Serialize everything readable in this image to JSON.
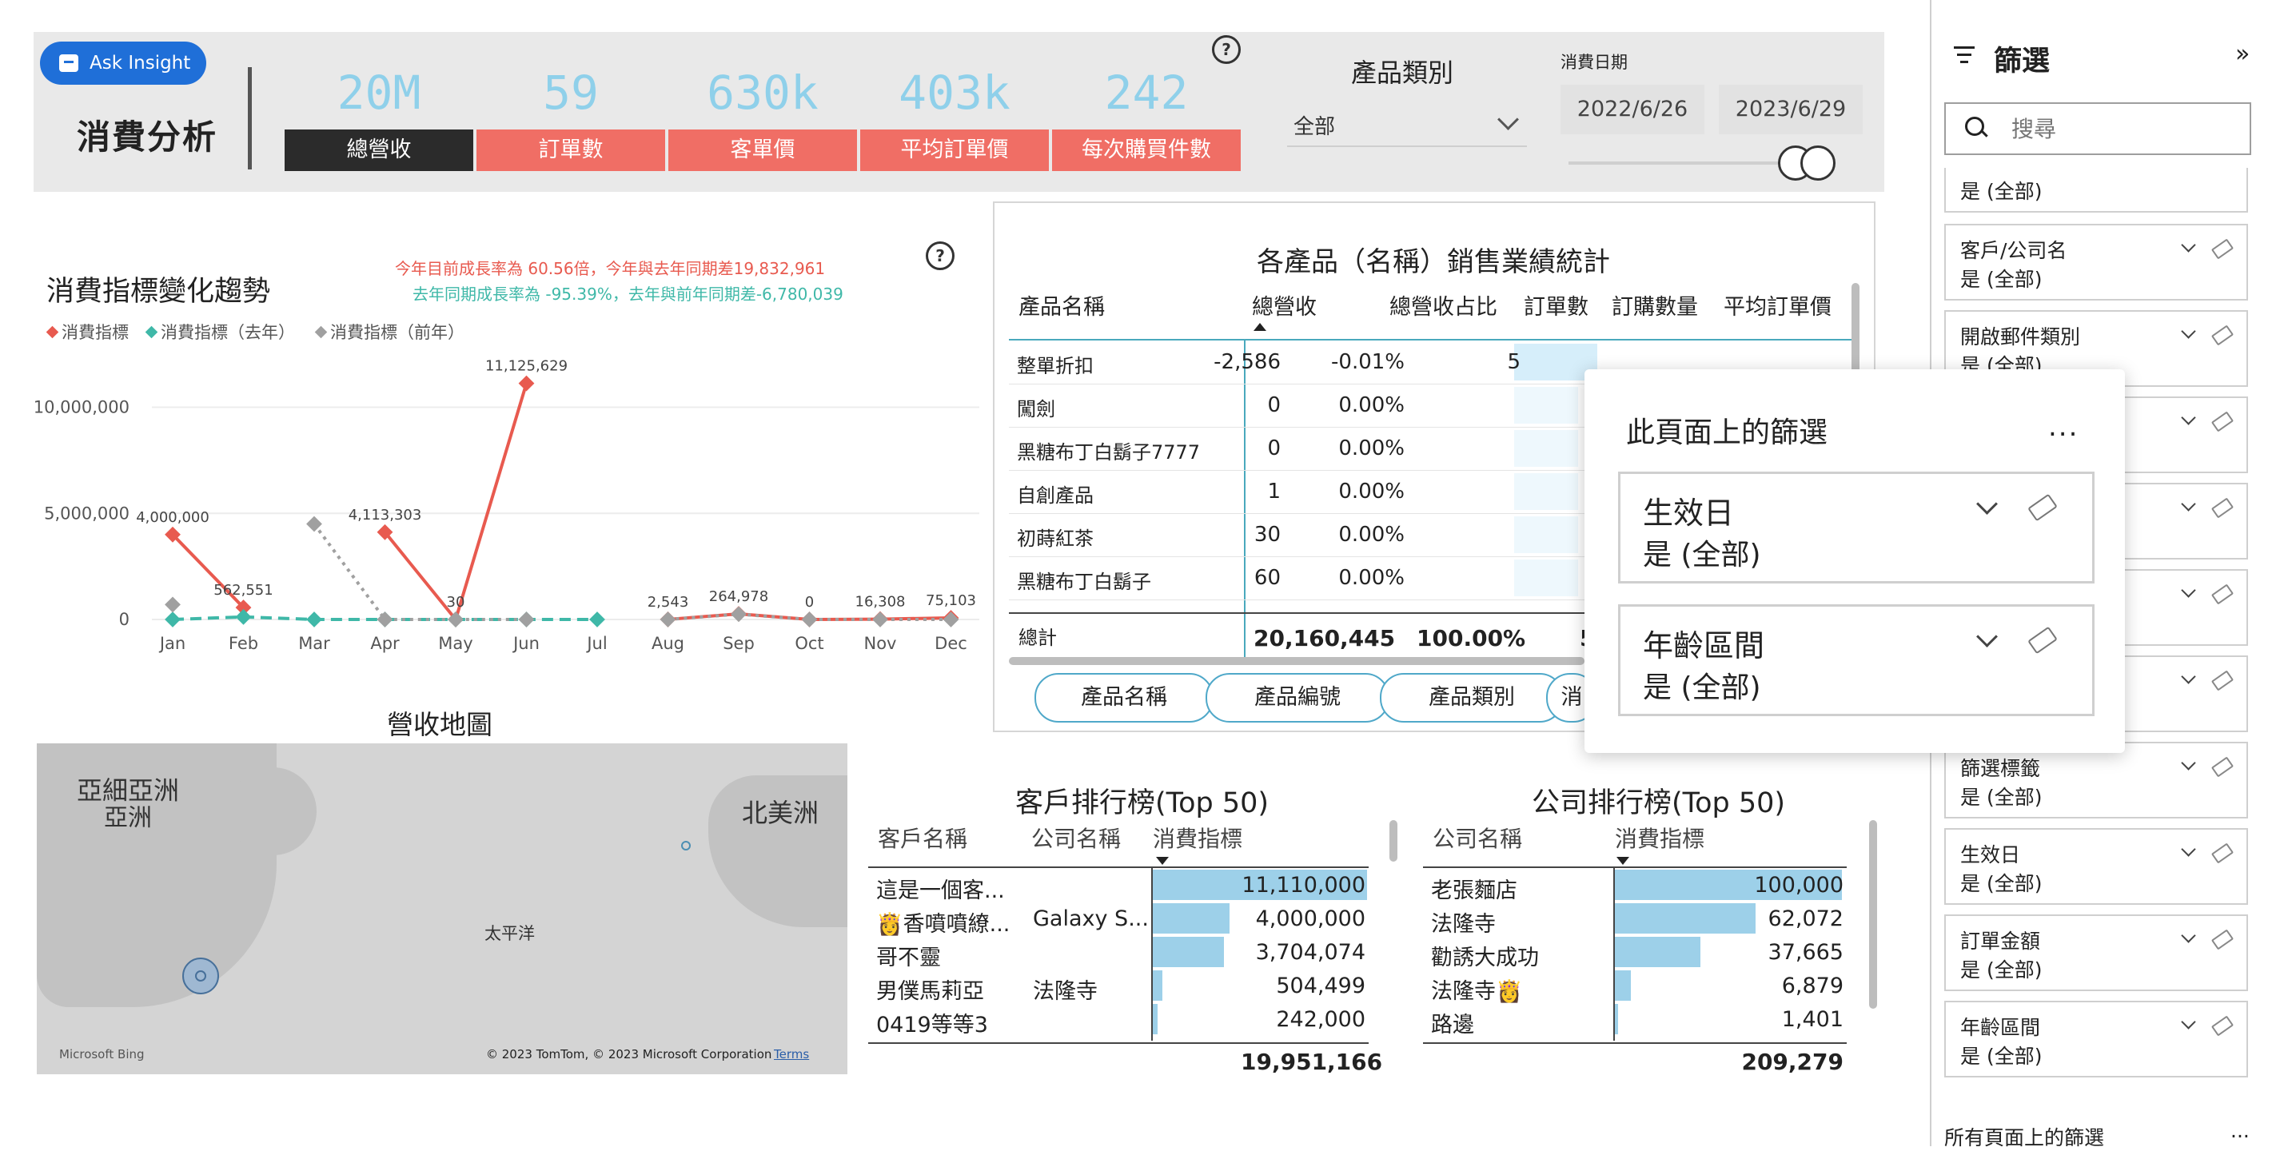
{
  "header": {
    "ask_insight": "Ask Insight",
    "page_title": "消費分析",
    "kpis": [
      {
        "value": "20M",
        "label": "總營收"
      },
      {
        "value": "59",
        "label": "訂單數"
      },
      {
        "value": "630k",
        "label": "客單價"
      },
      {
        "value": "403k",
        "label": "平均訂單價"
      },
      {
        "value": "242",
        "label": "每次購買件數"
      }
    ],
    "help": "?",
    "product_category": {
      "title": "產品類別",
      "value": "全部"
    },
    "date": {
      "title": "消費日期",
      "start": "2022/6/26",
      "end": "2023/6/29"
    }
  },
  "trend": {
    "title": "消費指標變化趨勢",
    "growth_line_1": "今年目前成長率為 60.56倍，今年與去年同期差19,832,961",
    "growth_line_2": "去年同期成長率為 -95.39%，去年與前年同期差-6,780,039",
    "help": "?",
    "legend": [
      "消費指標",
      "消費指標（去年）",
      "消費指標（前年）"
    ]
  },
  "chart_data": {
    "type": "line",
    "title": "消費指標變化趨勢",
    "categories": [
      "Jan",
      "Feb",
      "Mar",
      "Apr",
      "May",
      "Jun",
      "Jul",
      "Aug",
      "Sep",
      "Oct",
      "Nov",
      "Dec"
    ],
    "y_ticks": [
      "0",
      "5,000,000",
      "10,000,000"
    ],
    "ylim": [
      0,
      12000000
    ],
    "series": [
      {
        "name": "消費指標",
        "color": "#e85a4f",
        "style": "solid",
        "values": [
          4000000,
          562551,
          null,
          4113303,
          30,
          11125629,
          null,
          2543,
          264978,
          0,
          16308,
          75103
        ],
        "labels": [
          "4,000,000",
          "562,551",
          "",
          "4,113,303",
          "30",
          "11,125,629",
          "",
          "2,543",
          "264,978",
          "0",
          "16,308",
          "75,103"
        ]
      },
      {
        "name": "消費指標（去年）",
        "color": "#3fb8a8",
        "style": "dashed",
        "values": [
          0,
          120000,
          0,
          0,
          0,
          0,
          0,
          null,
          null,
          null,
          null,
          null
        ]
      },
      {
        "name": "消費指標（前年）",
        "color": "#a0a0a0",
        "style": "dotted",
        "values": [
          700000,
          null,
          4500000,
          0,
          0,
          0,
          null,
          0,
          250000,
          0,
          0,
          0
        ]
      }
    ],
    "legend_position": "top-left",
    "grid": true
  },
  "product_table": {
    "title": "各產品（名稱）銷售業績統計",
    "headers": [
      "產品名稱",
      "總營收",
      "總營收占比",
      "訂單數",
      "訂購數量",
      "平均訂單價"
    ],
    "rows": [
      {
        "name": "整單折扣",
        "revenue": "-2,586",
        "share": "-0.01%",
        "orders": "5"
      },
      {
        "name": "闖劍",
        "revenue": "0",
        "share": "0.00%",
        "orders": ""
      },
      {
        "name": "黑糖布丁白鬍子7777",
        "revenue": "0",
        "share": "0.00%",
        "orders": ""
      },
      {
        "name": "自創產品",
        "revenue": "1",
        "share": "0.00%",
        "orders": ""
      },
      {
        "name": "初蒔紅茶",
        "revenue": "30",
        "share": "0.00%",
        "orders": ""
      },
      {
        "name": "黑糖布丁白鬍子",
        "revenue": "60",
        "share": "0.00%",
        "orders": ""
      }
    ],
    "total": {
      "label": "總計",
      "revenue": "20,160,445",
      "share": "100.00%",
      "orders": "5"
    },
    "pills": [
      "產品名稱",
      "產品編號",
      "產品類別",
      "消"
    ]
  },
  "map": {
    "title": "營收地圖",
    "labels": {
      "asia_top": "亞細亞洲",
      "asia": "亞洲",
      "north_america": "北美洲",
      "pacific": "太平洋"
    },
    "attribution": "© 2023 TomTom, © 2023 Microsoft Corporation",
    "terms": "Terms",
    "brand": "Microsoft Bing"
  },
  "customer_rank": {
    "title": "客戶排行榜(Top 50)",
    "headers": [
      "客戶名稱",
      "公司名稱",
      "消費指標"
    ],
    "rows": [
      {
        "name": "這是一個客...",
        "company": "",
        "value": "11,110,000",
        "ratio": 1.0
      },
      {
        "name": "👸香噴噴繚...",
        "company": "Galaxy S...",
        "value": "4,000,000",
        "ratio": 0.36
      },
      {
        "name": "哥不靈",
        "company": "",
        "value": "3,704,074",
        "ratio": 0.333
      },
      {
        "name": "男僕馬莉亞",
        "company": "法隆寺",
        "value": "504,499",
        "ratio": 0.045
      },
      {
        "name": "0419等等3",
        "company": "",
        "value": "242,000",
        "ratio": 0.022
      }
    ],
    "total": "19,951,166"
  },
  "company_rank": {
    "title": "公司排行榜(Top 50)",
    "headers": [
      "公司名稱",
      "消費指標"
    ],
    "rows": [
      {
        "name": "老張麵店",
        "value": "100,000",
        "ratio": 1.0
      },
      {
        "name": "法隆寺",
        "value": "62,072",
        "ratio": 0.62
      },
      {
        "name": "勸誘大成功",
        "value": "37,665",
        "ratio": 0.377
      },
      {
        "name": "法隆寺👸",
        "value": "6,879",
        "ratio": 0.069
      },
      {
        "name": "路邊",
        "value": "1,401",
        "ratio": 0.014
      }
    ],
    "total": "209,279"
  },
  "popup": {
    "title": "此頁面上的篩選",
    "more": "...",
    "cards": [
      {
        "name": "生效日",
        "state": "是 (全部)"
      },
      {
        "name": "年齡區間",
        "state": "是 (全部)"
      }
    ]
  },
  "filters_pane": {
    "title": "篩選",
    "collapse": "»",
    "search_placeholder": "搜尋",
    "partial_state": "是 (全部)",
    "cards": [
      {
        "name": "客戶/公司名",
        "state": "是 (全部)"
      },
      {
        "name": "開啟郵件類別",
        "state": "是 (全部)"
      },
      {
        "name": "",
        "state": ""
      },
      {
        "name": "",
        "state": ""
      },
      {
        "name": "",
        "state": ""
      },
      {
        "name": "",
        "state": ""
      },
      {
        "name": "篩選標籤",
        "state": "是 (全部)"
      },
      {
        "name": "生效日",
        "state": "是 (全部)"
      },
      {
        "name": "訂單金額",
        "state": "是 (全部)"
      },
      {
        "name": "年齡區間",
        "state": "是 (全部)"
      }
    ],
    "all_pages": "所有頁面上的篩選",
    "all_pages_more": "..."
  }
}
